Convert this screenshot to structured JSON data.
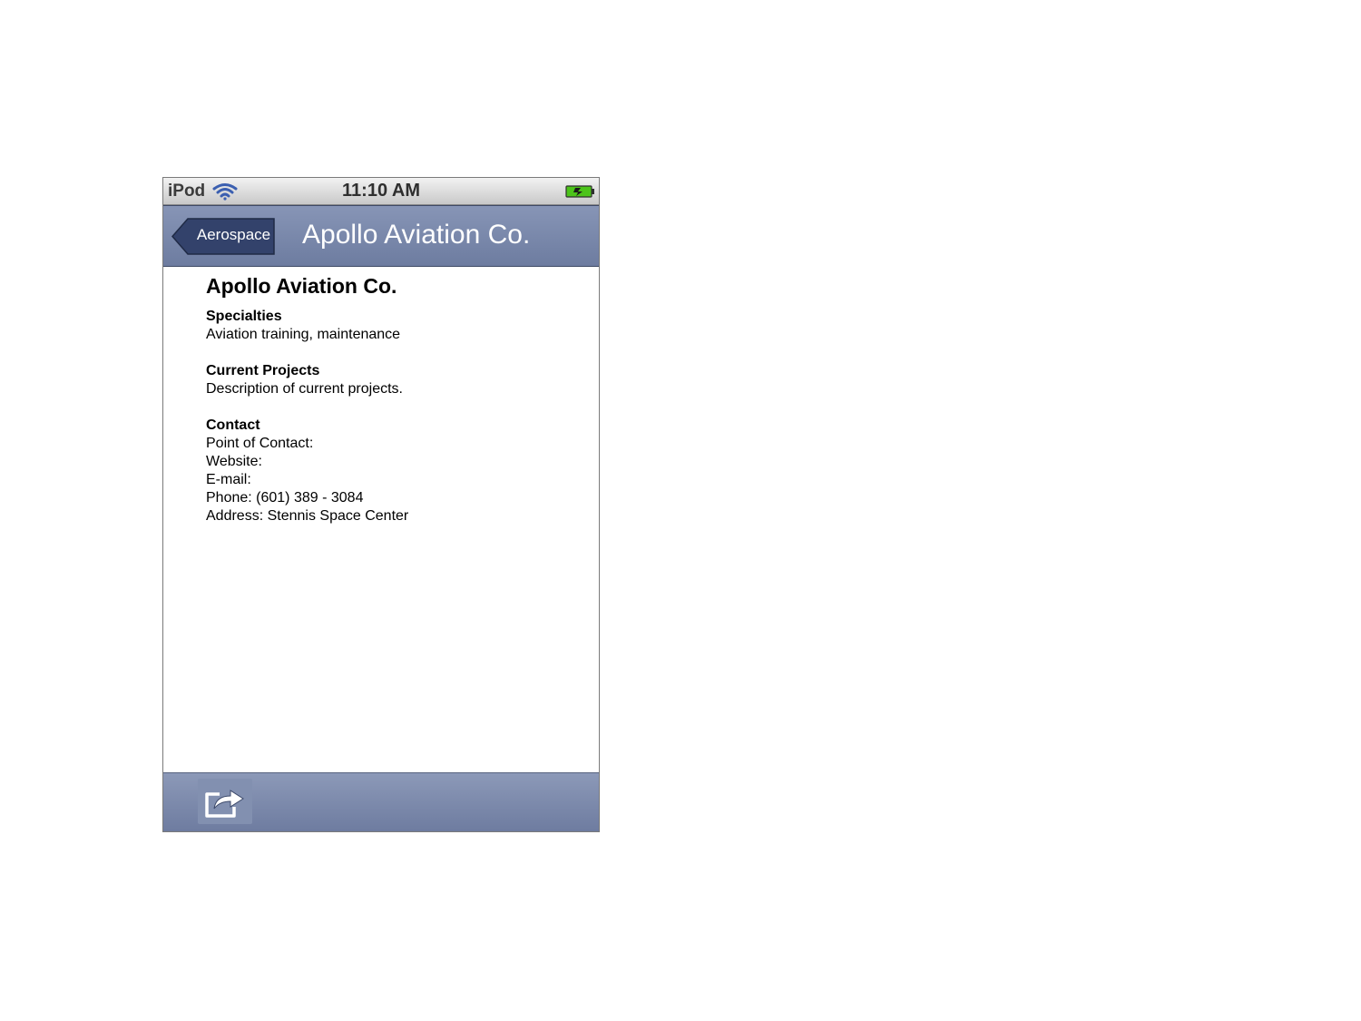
{
  "status_bar": {
    "carrier": "iPod",
    "time": "11:10 AM",
    "wifi_icon": "wifi-icon",
    "battery_icon": "battery-charging-icon"
  },
  "nav_bar": {
    "back_label": "Aerospace",
    "title": "Apollo Aviation Co."
  },
  "content": {
    "title": "Apollo Aviation Co.",
    "specialties": {
      "heading": "Specialties",
      "text": "Aviation training, maintenance"
    },
    "projects": {
      "heading": "Current Projects",
      "text": "Description of current projects."
    },
    "contact": {
      "heading": "Contact",
      "point_of_contact": "Point of Contact:",
      "website": "Website:",
      "email": "E-mail:",
      "phone": "Phone: (601) 389 - 3084",
      "address": "Address: Stennis Space Center"
    }
  },
  "toolbar": {
    "share_icon": "share-icon"
  },
  "colors": {
    "bar_blue": "#7381a5",
    "back_button": "#33426b",
    "battery_green": "#4cc41a"
  }
}
